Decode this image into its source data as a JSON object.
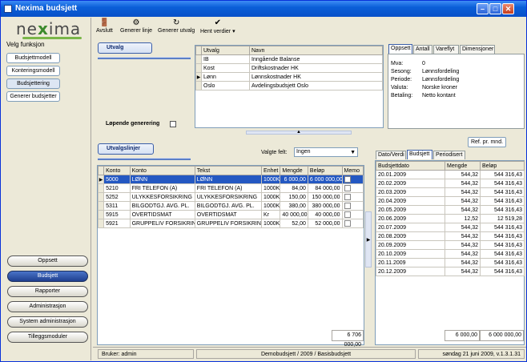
{
  "window": {
    "title": "Nexima budsjett"
  },
  "brand": {
    "logo": "nexima"
  },
  "left": {
    "label": "Velg funksjon",
    "functions": [
      "Budsjettmodell",
      "Konteringsmodell",
      "Budsjettering",
      "Generer budsjetter"
    ],
    "selected_function": "Budsjettering",
    "nav": [
      "Oppsett",
      "Budsjett",
      "Rapporter",
      "Administrasjon",
      "System administrasjon",
      "Tilleggsmoduler"
    ],
    "selected_nav": "Budsjett"
  },
  "toolbar": {
    "exit": "Avslutt",
    "gen_line": "Generer linje",
    "gen_sel": "Generer utvalg",
    "fetch": "Hent verdier"
  },
  "utvalg": {
    "header": "Utvalg",
    "cols": [
      "Utvalg",
      "Navn"
    ],
    "rows": [
      {
        "code": "IB",
        "name": "Inngående Balanse"
      },
      {
        "code": "Kost",
        "name": "Driftskostnader HK"
      },
      {
        "code": "Lønn",
        "name": "Lønnskostnader HK"
      },
      {
        "code": "Oslo",
        "name": "Avdelingsbudsjett Oslo"
      }
    ],
    "current_row": 2,
    "running_label": "Løpende generering"
  },
  "info_tabs": [
    "Oppsett",
    "Antall",
    "Vareflyt",
    "Dimensjoner"
  ],
  "info": [
    {
      "k": "Mva:",
      "v": "0"
    },
    {
      "k": "Sesong:",
      "v": "Lønnsfordeling"
    },
    {
      "k": "Periode:",
      "v": "Lønnsfordeling"
    },
    {
      "k": "Valuta:",
      "v": "Norske kroner"
    },
    {
      "k": "Betaling:",
      "v": "Netto kontant"
    }
  ],
  "ref_button": "Ref. pr. mnd.",
  "lines": {
    "header": "Utvalgslinjer",
    "field_label": "Valgte felt:",
    "field_value": "Ingen",
    "cols": [
      "Konto",
      "Konto",
      "Tekst",
      "Enhet",
      "Mengde",
      "Beløp",
      "Memo"
    ],
    "rows": [
      [
        "5000",
        "LØNN",
        "LØNN",
        "1000K",
        "6 000,00",
        "6 000 000,00"
      ],
      [
        "5210",
        "FRI TELEFON (A)",
        "FRI TELEFON (A)",
        "1000K",
        "84,00",
        "84 000,00"
      ],
      [
        "5252",
        "ULYKKESFORSIKRING",
        "ULYKKESFORSIKRING",
        "1000K",
        "150,00",
        "150 000,00"
      ],
      [
        "5311",
        "BILGODTGJ. AVG. PL.",
        "BILGODTGJ. AVG. PL.",
        "1000K",
        "380,00",
        "380 000,00"
      ],
      [
        "5915",
        "OVERTIDSMAT",
        "OVERTIDSMAT",
        "Kr",
        "40 000,00",
        "40 000,00"
      ],
      [
        "5921",
        "GRUPPELIV FORSIKRIN",
        "GRUPPELIV FORSIKRIN",
        "1000K",
        "52,00",
        "52 000,00"
      ]
    ],
    "total": "6 706 000,00"
  },
  "budget_tabs": [
    "Dato/Verdi",
    "Budsjett",
    "Periodisert"
  ],
  "budget": {
    "cols": [
      "Budsjettdato",
      "Mengde",
      "Beløp"
    ],
    "rows": [
      [
        "20.01.2009",
        "544,32",
        "544 316,43"
      ],
      [
        "20.02.2009",
        "544,32",
        "544 316,43"
      ],
      [
        "20.03.2009",
        "544,32",
        "544 316,43"
      ],
      [
        "20.04.2009",
        "544,32",
        "544 316,43"
      ],
      [
        "20.05.2009",
        "544,32",
        "544 316,43"
      ],
      [
        "20.06.2009",
        "12,52",
        "12 519,28"
      ],
      [
        "20.07.2009",
        "544,32",
        "544 316,43"
      ],
      [
        "20.08.2009",
        "544,32",
        "544 316,43"
      ],
      [
        "20.09.2009",
        "544,32",
        "544 316,43"
      ],
      [
        "20.10.2009",
        "544,32",
        "544 316,43"
      ],
      [
        "20.11.2009",
        "544,32",
        "544 316,43"
      ],
      [
        "20.12.2009",
        "544,32",
        "544 316,43"
      ]
    ],
    "total_qty": "6 000,00",
    "total_amt": "6 000 000,00"
  },
  "status": {
    "user": "Bruker: admin",
    "context": "Demobudsjett / 2009 / Basisbudsjett",
    "date": "søndag 21 juni 2009, v.1.3.1.31"
  }
}
